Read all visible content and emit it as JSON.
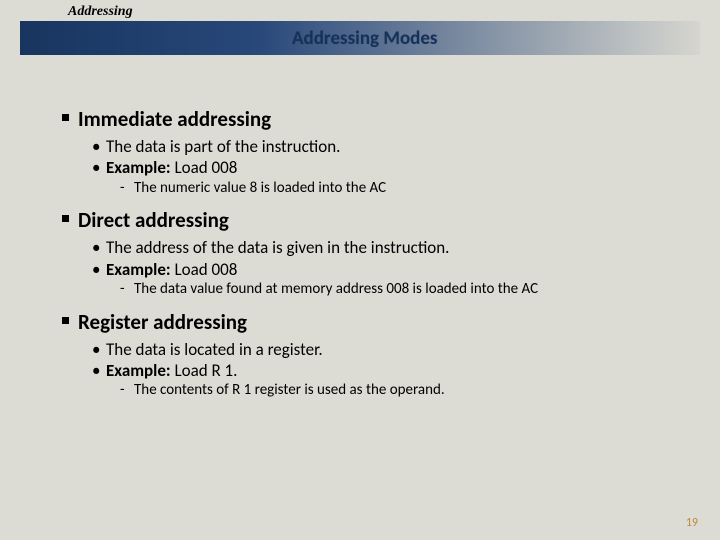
{
  "header": {
    "topic": "Addressing",
    "title": "Addressing Modes"
  },
  "sections": [
    {
      "heading": "Immediate addressing",
      "bullets": [
        {
          "pre": "",
          "bold": "",
          "post": "The data is part of the instruction."
        },
        {
          "pre": "",
          "bold": "Example:",
          "post": " Load 008"
        }
      ],
      "sub": "The numeric value 8 is loaded into the AC"
    },
    {
      "heading": "Direct addressing",
      "bullets": [
        {
          "pre": "",
          "bold": "",
          "post": "The address of the data is given in the instruction."
        },
        {
          "pre": "",
          "bold": "Example:",
          "post": " Load 008"
        }
      ],
      "sub": "The data value found at memory address 008 is loaded into the AC"
    },
    {
      "heading": "Register addressing",
      "bullets": [
        {
          "pre": "",
          "bold": "",
          "post": "The data is located in a register."
        },
        {
          "pre": "",
          "bold": "Example:",
          "post": " Load R 1."
        }
      ],
      "sub": "The contents of R 1 register is used as the operand."
    }
  ],
  "page_number": "19"
}
